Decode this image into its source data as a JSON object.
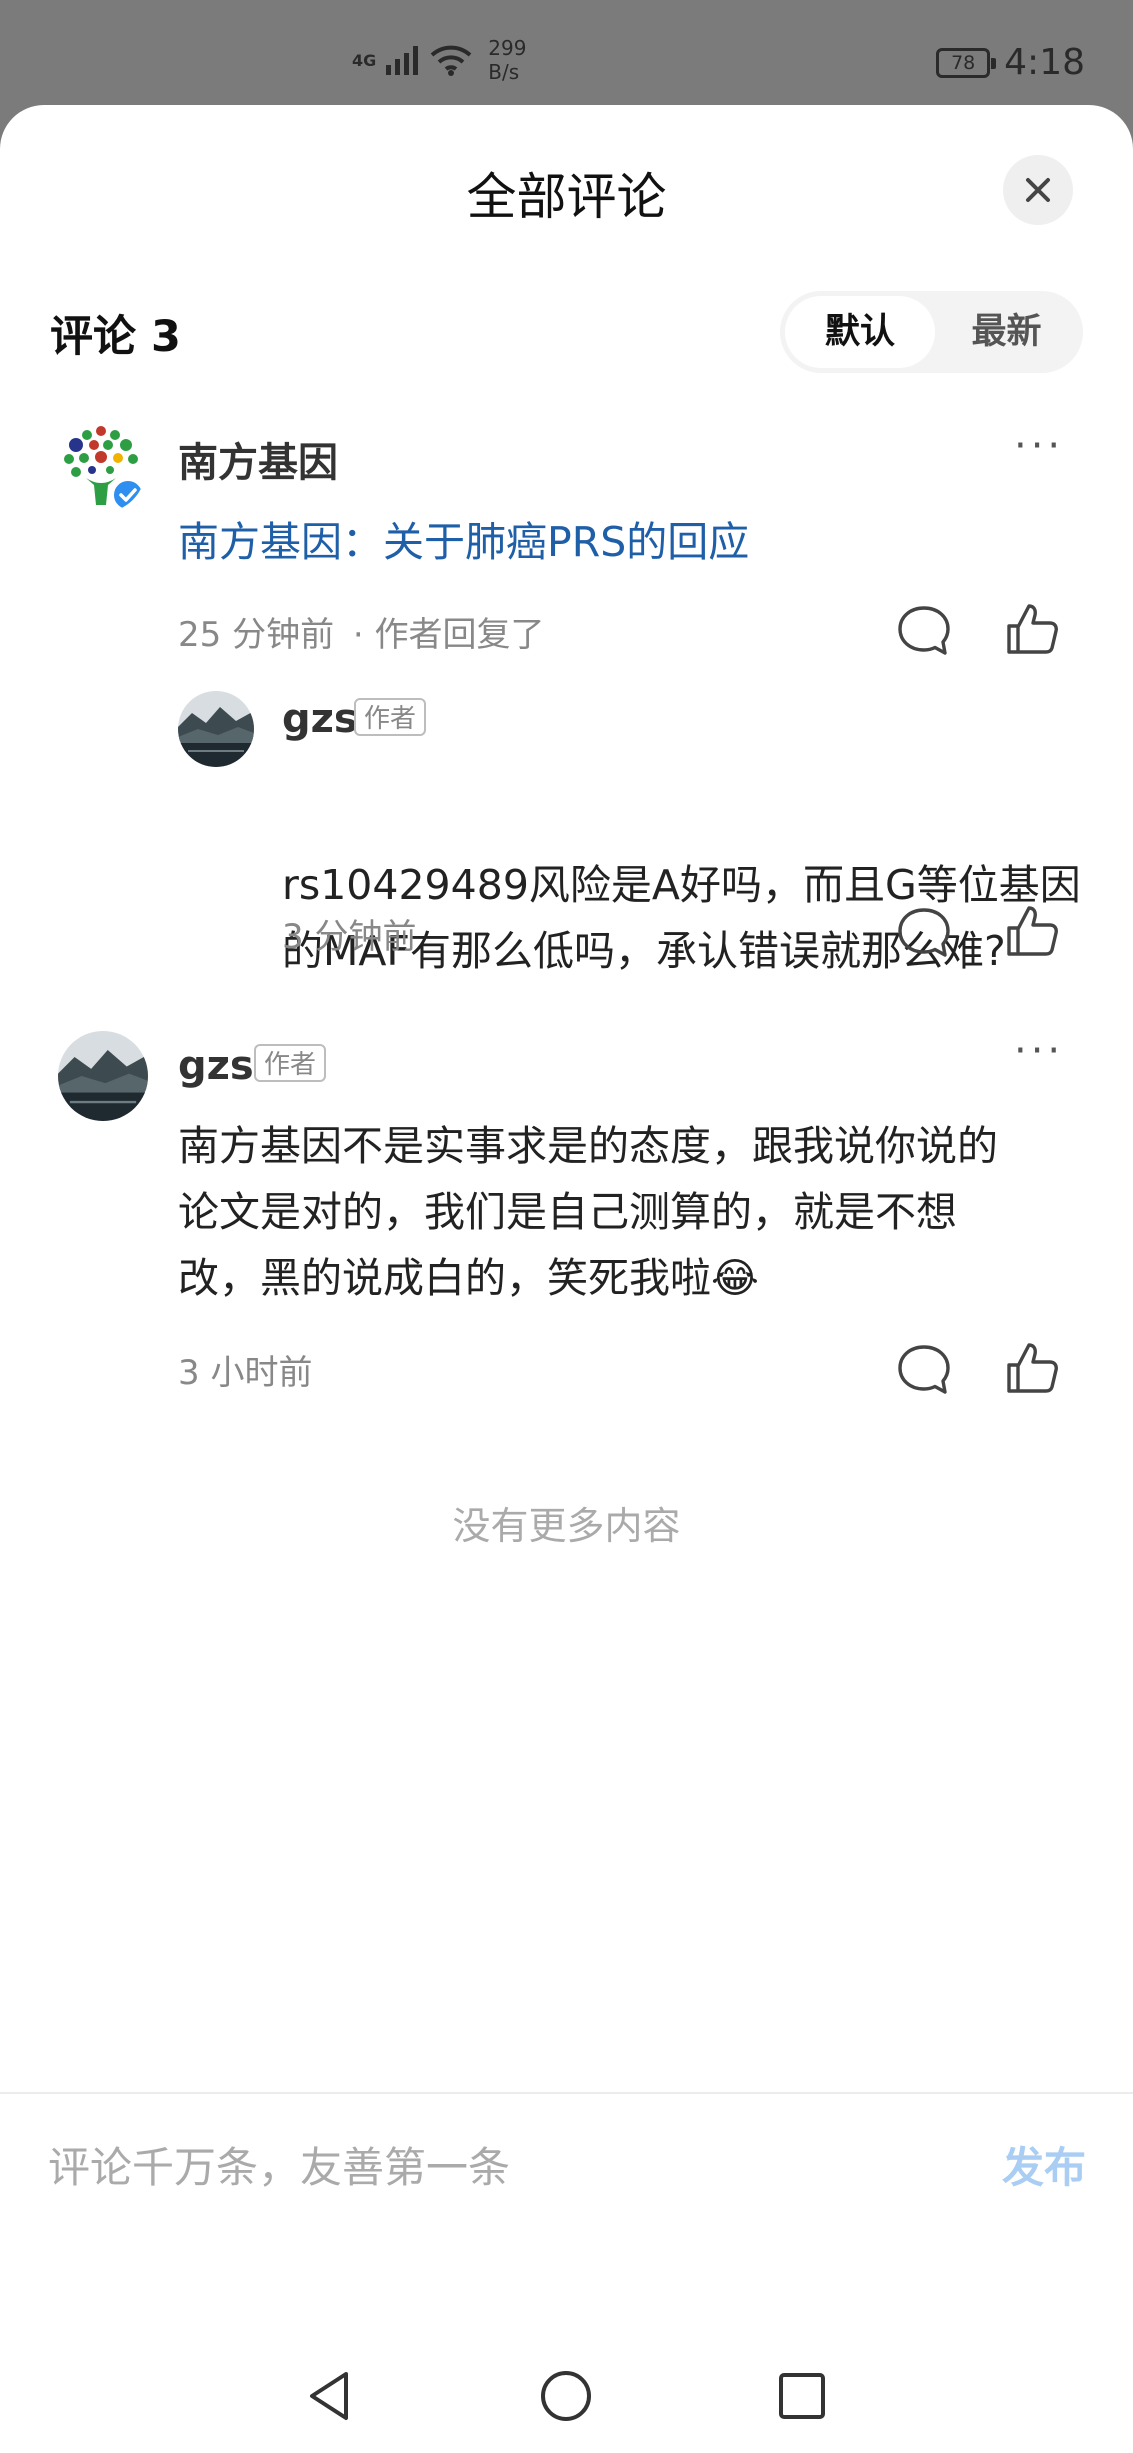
{
  "status_bar": {
    "network": "4G",
    "speed_value": "299",
    "speed_unit": "B/s",
    "battery": "78",
    "time": "4:18"
  },
  "sheet": {
    "title": "全部评论",
    "comment_count": "评论 3",
    "sort_options": [
      "默认",
      "最新"
    ],
    "selected_sort": "默认"
  },
  "comments": [
    {
      "author": "南方基因",
      "verified": true,
      "content": "南方基因：关于肺癌PRS的回应",
      "time": "25 分钟前",
      "reply_note": "· 作者回复了",
      "replies": [
        {
          "author": "gzs",
          "tag": "作者",
          "content_line1": "rs10429489风险是A好吗，而且G等位基因",
          "content_line2": "的MAF有那么低吗，承认错误就那么难?",
          "time": "3 分钟前"
        }
      ]
    },
    {
      "author": "gzs",
      "tag": "作者",
      "content_line1": "南方基因不是实事求是的态度，跟我说你说的",
      "content_line2": "论文是对的，我们是自己测算的，就是不想",
      "content_line3": "改，黑的说成白的，笑死我啦😂",
      "time": "3 小时前"
    }
  ],
  "no_more": "没有更多内容",
  "composer": {
    "placeholder": "评论千万条，友善第一条",
    "publish_label": "发布"
  },
  "colors": {
    "link": "#1f5fa8",
    "publish_disabled": "#a9cdf3",
    "verified_badge": "#2f8ff0"
  }
}
